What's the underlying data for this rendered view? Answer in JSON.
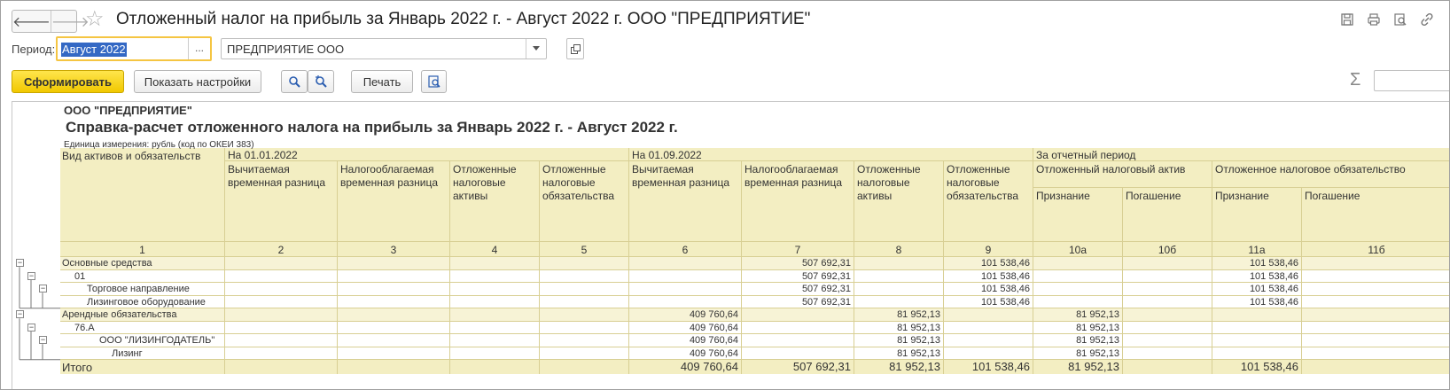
{
  "window": {
    "title": "Отложенный налог на прибыль за Январь 2022 г. - Август 2022 г. ООО \"ПРЕДПРИЯТИЕ\"",
    "back_glyph": "🡐",
    "forward_glyph": "🡒",
    "star_glyph": "☆",
    "icons": [
      "save-icon",
      "print-icon",
      "preview-icon",
      "link-icon"
    ]
  },
  "filters": {
    "period_label": "Период:",
    "period_value": "Август 2022",
    "period_button": "...",
    "organization_value": "ПРЕДПРИЯТИЕ ООО"
  },
  "toolbar": {
    "generate_label": "Сформировать",
    "settings_label": "Показать настройки",
    "print_label": "Печать",
    "sigma": "Σ"
  },
  "report": {
    "org": "ООО \"ПРЕДПРИЯТИЕ\"",
    "title": "Справка-расчет отложенного налога на прибыль за Январь 2022 г. - Август 2022 г.",
    "unit": "Единица измерения: рубль (код по ОКЕИ 383)",
    "header": {
      "col_kind": "Вид активов и обязательств",
      "group_start": "На 01.01.2022",
      "group_end": "На 01.09.2022",
      "group_period": "За отчетный период",
      "deductible": "Вычитаемая временная разница",
      "taxable": "Налогооблагаемая временная разница",
      "deferred_assets": "Отложенные налоговые активы",
      "deferred_liabilities": "Отложенные налоговые обязательства",
      "dta": "Отложенный налоговый актив",
      "dtl": "Отложенное налоговое обязательство",
      "recognition": "Признание",
      "repayment": "Погашение",
      "col_numbers": [
        "1",
        "2",
        "3",
        "4",
        "5",
        "6",
        "7",
        "8",
        "9",
        "10а",
        "10б",
        "11а",
        "11б"
      ]
    },
    "rows": [
      {
        "label": "Основные средства",
        "indent": 0,
        "group": true,
        "values": [
          "",
          "",
          "",
          "",
          "",
          "507 692,31",
          "",
          "101 538,46",
          "",
          "",
          "101 538,46",
          ""
        ]
      },
      {
        "label": "01",
        "indent": 1,
        "group": false,
        "values": [
          "",
          "",
          "",
          "",
          "",
          "507 692,31",
          "",
          "101 538,46",
          "",
          "",
          "101 538,46",
          ""
        ]
      },
      {
        "label": "Торговое направление",
        "indent": 2,
        "group": false,
        "values": [
          "",
          "",
          "",
          "",
          "",
          "507 692,31",
          "",
          "101 538,46",
          "",
          "",
          "101 538,46",
          ""
        ]
      },
      {
        "label": "Лизинговое оборудование",
        "indent": 2,
        "group": false,
        "values": [
          "",
          "",
          "",
          "",
          "",
          "507 692,31",
          "",
          "101 538,46",
          "",
          "",
          "101 538,46",
          ""
        ]
      },
      {
        "label": "Арендные обязательства",
        "indent": 0,
        "group": true,
        "values": [
          "",
          "",
          "",
          "",
          "409 760,64",
          "",
          "81 952,13",
          "",
          "81 952,13",
          "",
          "",
          ""
        ]
      },
      {
        "label": "76.А",
        "indent": 1,
        "group": false,
        "values": [
          "",
          "",
          "",
          "",
          "409 760,64",
          "",
          "81 952,13",
          "",
          "81 952,13",
          "",
          "",
          ""
        ]
      },
      {
        "label": "ООО \"ЛИЗИНГОДАТЕЛЬ\"",
        "indent": 3,
        "group": false,
        "values": [
          "",
          "",
          "",
          "",
          "409 760,64",
          "",
          "81 952,13",
          "",
          "81 952,13",
          "",
          "",
          ""
        ]
      },
      {
        "label": "Лизинг",
        "indent": 4,
        "group": false,
        "values": [
          "",
          "",
          "",
          "",
          "409 760,64",
          "",
          "81 952,13",
          "",
          "81 952,13",
          "",
          "",
          ""
        ]
      }
    ],
    "total": {
      "label": "Итого",
      "values": [
        "",
        "",
        "",
        "",
        "409 760,64",
        "507 692,31",
        "81 952,13",
        "101 538,46",
        "81 952,13",
        "",
        "101 538,46",
        ""
      ]
    }
  },
  "colors": {
    "header_bg": "#f3eec2",
    "group_row_bg": "#f7f3d6",
    "total_bg": "#f3eec2",
    "accent_yellow": "#f5c542",
    "grid_line": "#d8cf94"
  }
}
